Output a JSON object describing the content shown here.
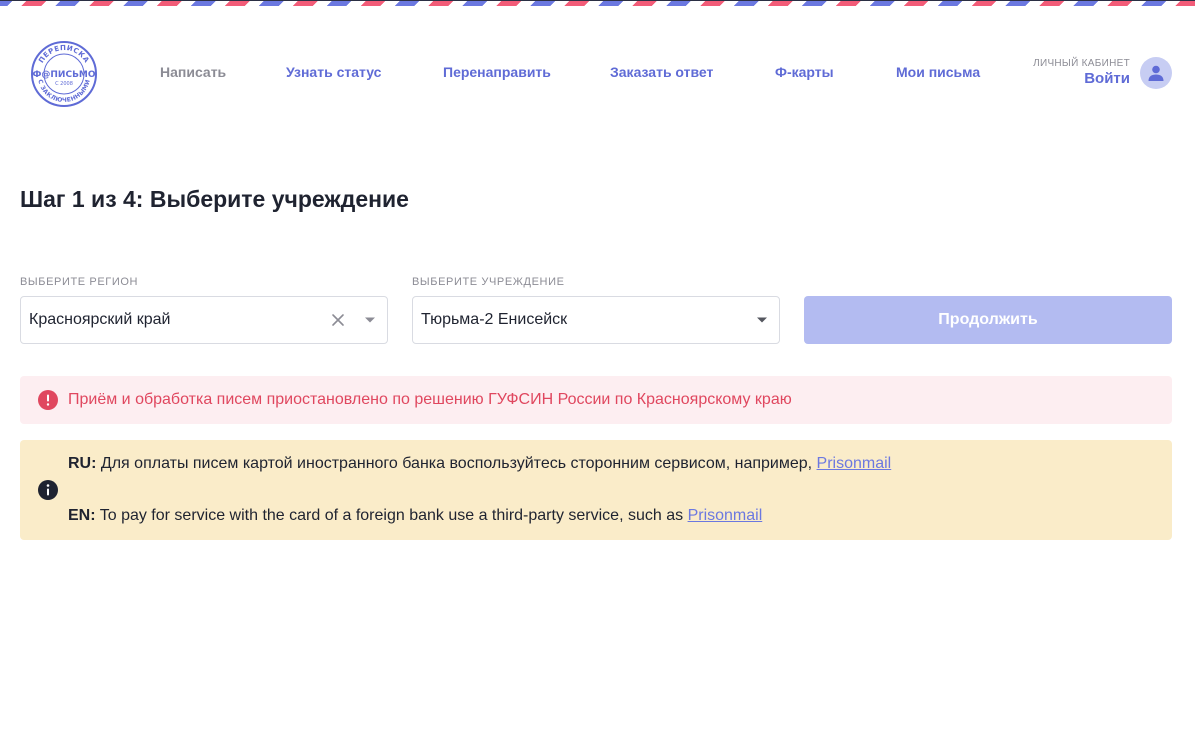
{
  "logo": {
    "top_text": "ПЕРЕПИСКА",
    "main_text": "Ф@ПИСЬМО",
    "year_text": "С 2008",
    "bottom_text": "С ЗАКЛЮЧЕННЫМИ"
  },
  "nav": {
    "items": [
      {
        "label": "Написать"
      },
      {
        "label": "Узнать статус"
      },
      {
        "label": "Перенаправить"
      },
      {
        "label": "Заказать ответ"
      },
      {
        "label": "Ф-карты"
      },
      {
        "label": "Мои письма"
      }
    ]
  },
  "account": {
    "label": "ЛИЧНЫЙ КАБИНЕТ",
    "login": "Войти"
  },
  "page": {
    "title": "Шаг 1 из 4: Выберите учреждение"
  },
  "form": {
    "region_label": "ВЫБЕРИТЕ РЕГИОН",
    "region_value": "Красноярский край",
    "institution_label": "ВЫБЕРИТЕ УЧРЕЖДЕНИЕ",
    "institution_value": "Тюрьма-2 Енисейск",
    "continue_label": "Продолжить"
  },
  "alerts": {
    "error_text": "Приём и обработка писем приостановлено по решению ГУФСИН России по Красноярскому краю",
    "info_ru_prefix": "RU:",
    "info_ru_text": " Для оплаты писем картой иностранного банка воспользуйтесь сторонним сервисом, например, ",
    "info_ru_link": "Prisonmail",
    "info_en_prefix": "EN:",
    "info_en_text": " To pay for service with the card of a foreign bank use a third-party service, such as ",
    "info_en_link": "Prisonmail"
  },
  "colors": {
    "accent": "#5f6bd6",
    "button_disabled": "#b3bbf1",
    "error_bg": "#fdeef1",
    "error_text": "#e0475f",
    "info_bg": "#faecc9"
  }
}
